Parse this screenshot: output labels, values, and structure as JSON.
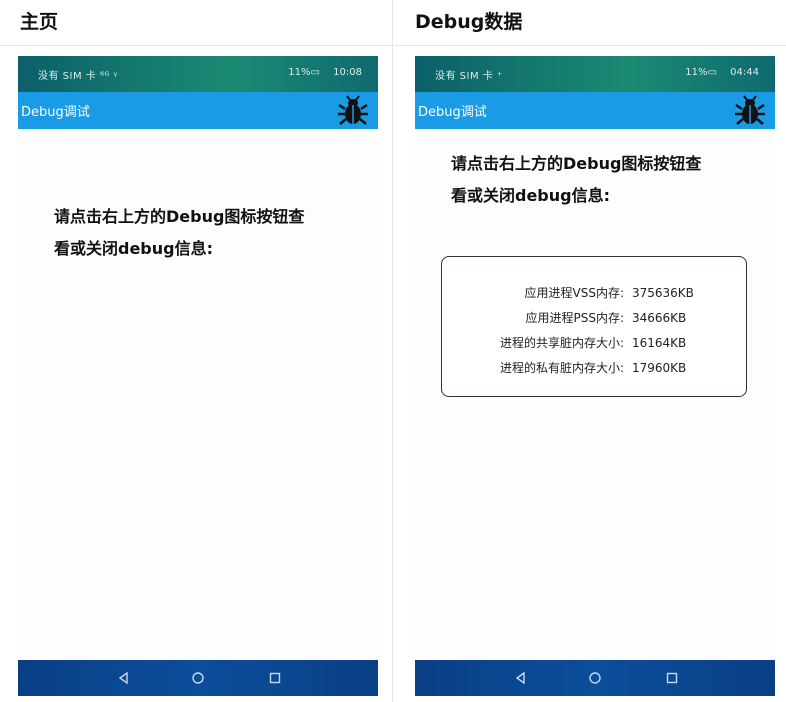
{
  "left": {
    "header": "主页",
    "status": {
      "left": "没有 SIM 卡 ⁶ᴳ ᵞ",
      "battery": "11%▭",
      "time": "10:08"
    },
    "app_title": "Debug调试",
    "hint_line1": "请点击右上方的Debug图标按钮查",
    "hint_line2": "看或关闭debug信息:"
  },
  "right": {
    "header": "Debug数据",
    "status": {
      "left": "没有 SIM 卡 ⁺",
      "battery": "11%▭",
      "time": "04:44"
    },
    "app_title": "Debug调试",
    "hint_line1": "请点击右上方的Debug图标按钮查",
    "hint_line2": "看或关闭debug信息:",
    "debug_rows": [
      {
        "label": "应用进程VSS内存:",
        "value": "375636KB"
      },
      {
        "label": "应用进程PSS内存:",
        "value": "34666KB"
      },
      {
        "label": "进程的共享脏内存大小:",
        "value": "16164KB"
      },
      {
        "label": "进程的私有脏内存大小:",
        "value": "17960KB"
      }
    ]
  },
  "icons": {
    "bug": "bug-icon",
    "back": "back-triangle-icon",
    "home": "home-circle-icon",
    "recent": "recent-square-icon"
  },
  "colors": {
    "app_bar": "#1a9be6",
    "status_bar": "#157a6e",
    "nav_bar": "#0b4e9a",
    "debug_border": "#3a2a40"
  }
}
